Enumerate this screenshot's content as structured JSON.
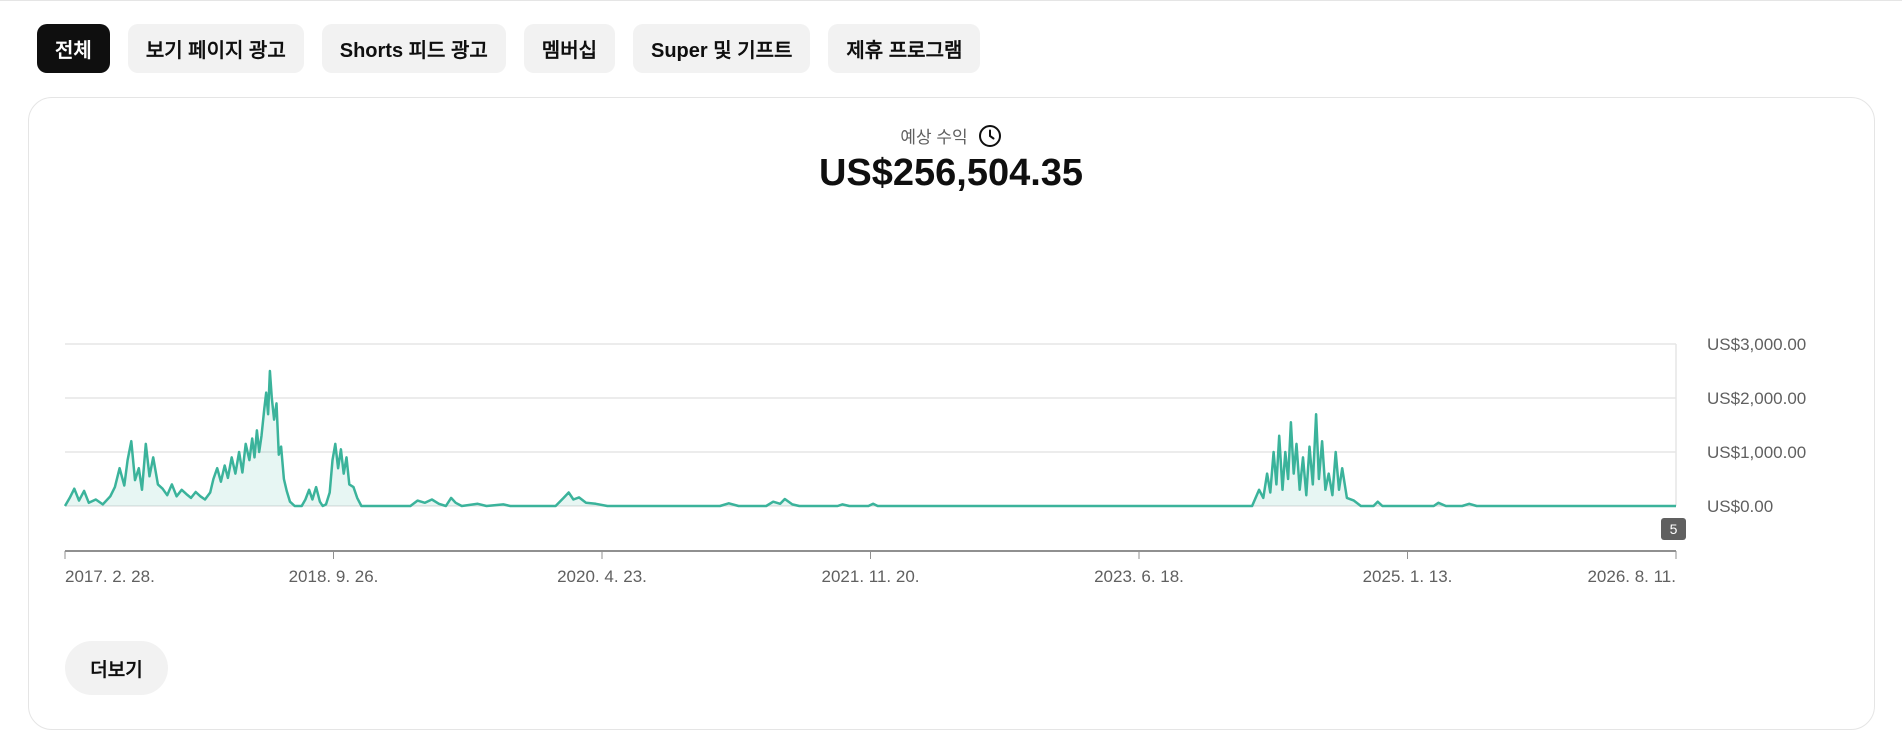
{
  "tabs": [
    {
      "label": "전체",
      "active": true
    },
    {
      "label": "보기 페이지 광고",
      "active": false
    },
    {
      "label": "Shorts 피드 광고",
      "active": false
    },
    {
      "label": "멤버십",
      "active": false
    },
    {
      "label": "Super 및 기프트",
      "active": false
    },
    {
      "label": "제휴 프로그램",
      "active": false
    }
  ],
  "metric": {
    "label": "예상 수익",
    "icon": "clock-icon",
    "value": "US$256,504.35"
  },
  "more_button": {
    "label": "더보기"
  },
  "colors": {
    "accent": "#3bb39b",
    "active_chip": "#0f0f0f",
    "chip": "#f2f2f2",
    "grid": "#e5e5e5"
  },
  "chart_data": {
    "type": "area",
    "title": "",
    "xlabel": "",
    "ylabel": "",
    "x_tick_labels": [
      "2017. 2. 28.",
      "2018. 9. 26.",
      "2020. 4. 23.",
      "2021. 11. 20.",
      "2023. 6. 18.",
      "2025. 1. 13.",
      "2026. 8. 11."
    ],
    "x_range": [
      "2017-02-28",
      "2026-08-11"
    ],
    "y_tick_labels": [
      "US$0.00",
      "US$1,000.00",
      "US$2,000.00",
      "US$3,000.00"
    ],
    "ylim": [
      0,
      3000
    ],
    "grid": true,
    "axis_position": "right",
    "marker_badge": "5",
    "series": [
      {
        "points": [
          [
            "2017-02-28",
            0
          ],
          [
            "2017-03-10",
            150
          ],
          [
            "2017-03-20",
            320
          ],
          [
            "2017-03-30",
            100
          ],
          [
            "2017-04-10",
            280
          ],
          [
            "2017-04-20",
            60
          ],
          [
            "2017-05-05",
            120
          ],
          [
            "2017-05-20",
            30
          ],
          [
            "2017-06-05",
            180
          ],
          [
            "2017-06-15",
            350
          ],
          [
            "2017-06-25",
            700
          ],
          [
            "2017-07-05",
            380
          ],
          [
            "2017-07-12",
            850
          ],
          [
            "2017-07-20",
            1200
          ],
          [
            "2017-07-28",
            480
          ],
          [
            "2017-08-05",
            700
          ],
          [
            "2017-08-12",
            300
          ],
          [
            "2017-08-20",
            1150
          ],
          [
            "2017-08-28",
            550
          ],
          [
            "2017-09-05",
            900
          ],
          [
            "2017-09-15",
            400
          ],
          [
            "2017-09-25",
            320
          ],
          [
            "2017-10-05",
            200
          ],
          [
            "2017-10-15",
            400
          ],
          [
            "2017-10-25",
            180
          ],
          [
            "2017-11-05",
            300
          ],
          [
            "2017-11-15",
            220
          ],
          [
            "2017-11-25",
            150
          ],
          [
            "2017-12-05",
            260
          ],
          [
            "2017-12-15",
            180
          ],
          [
            "2017-12-25",
            120
          ],
          [
            "2018-01-05",
            250
          ],
          [
            "2018-01-12",
            500
          ],
          [
            "2018-01-20",
            700
          ],
          [
            "2018-01-28",
            450
          ],
          [
            "2018-02-05",
            750
          ],
          [
            "2018-02-12",
            520
          ],
          [
            "2018-02-20",
            900
          ],
          [
            "2018-02-28",
            600
          ],
          [
            "2018-03-08",
            1000
          ],
          [
            "2018-03-15",
            620
          ],
          [
            "2018-03-22",
            1150
          ],
          [
            "2018-03-30",
            850
          ],
          [
            "2018-04-05",
            1250
          ],
          [
            "2018-04-10",
            900
          ],
          [
            "2018-04-15",
            1400
          ],
          [
            "2018-04-20",
            1000
          ],
          [
            "2018-04-25",
            1300
          ],
          [
            "2018-05-01",
            1800
          ],
          [
            "2018-05-05",
            2100
          ],
          [
            "2018-05-09",
            1700
          ],
          [
            "2018-05-13",
            2500
          ],
          [
            "2018-05-17",
            2000
          ],
          [
            "2018-05-22",
            1600
          ],
          [
            "2018-05-27",
            1900
          ],
          [
            "2018-06-01",
            950
          ],
          [
            "2018-06-06",
            1100
          ],
          [
            "2018-06-12",
            500
          ],
          [
            "2018-06-18",
            280
          ],
          [
            "2018-06-25",
            80
          ],
          [
            "2018-07-05",
            0
          ],
          [
            "2018-07-20",
            0
          ],
          [
            "2018-07-28",
            120
          ],
          [
            "2018-08-05",
            300
          ],
          [
            "2018-08-12",
            120
          ],
          [
            "2018-08-20",
            350
          ],
          [
            "2018-08-28",
            80
          ],
          [
            "2018-09-03",
            0
          ],
          [
            "2018-09-10",
            30
          ],
          [
            "2018-09-18",
            250
          ],
          [
            "2018-09-24",
            850
          ],
          [
            "2018-09-30",
            1150
          ],
          [
            "2018-10-06",
            700
          ],
          [
            "2018-10-12",
            1050
          ],
          [
            "2018-10-18",
            600
          ],
          [
            "2018-10-24",
            900
          ],
          [
            "2018-10-30",
            400
          ],
          [
            "2018-11-08",
            350
          ],
          [
            "2018-11-16",
            150
          ],
          [
            "2018-11-25",
            0
          ],
          [
            "2019-03-10",
            0
          ],
          [
            "2019-03-25",
            100
          ],
          [
            "2019-04-10",
            60
          ],
          [
            "2019-04-25",
            120
          ],
          [
            "2019-05-10",
            40
          ],
          [
            "2019-05-25",
            0
          ],
          [
            "2019-06-05",
            150
          ],
          [
            "2019-06-15",
            60
          ],
          [
            "2019-06-28",
            0
          ],
          [
            "2019-08-01",
            40
          ],
          [
            "2019-08-20",
            0
          ],
          [
            "2019-09-25",
            30
          ],
          [
            "2019-10-10",
            0
          ],
          [
            "2019-11-10",
            0
          ],
          [
            "2020-01-15",
            0
          ],
          [
            "2020-02-01",
            150
          ],
          [
            "2020-02-12",
            250
          ],
          [
            "2020-02-22",
            120
          ],
          [
            "2020-03-05",
            160
          ],
          [
            "2020-03-20",
            60
          ],
          [
            "2020-04-10",
            40
          ],
          [
            "2020-05-05",
            0
          ],
          [
            "2021-01-01",
            0
          ],
          [
            "2021-01-20",
            50
          ],
          [
            "2021-02-10",
            0
          ],
          [
            "2021-04-10",
            0
          ],
          [
            "2021-04-25",
            80
          ],
          [
            "2021-05-10",
            40
          ],
          [
            "2021-05-20",
            130
          ],
          [
            "2021-06-05",
            30
          ],
          [
            "2021-06-20",
            0
          ],
          [
            "2021-09-10",
            0
          ],
          [
            "2021-09-20",
            30
          ],
          [
            "2021-10-05",
            0
          ],
          [
            "2021-11-15",
            0
          ],
          [
            "2021-11-25",
            40
          ],
          [
            "2021-12-05",
            0
          ],
          [
            "2024-02-15",
            0
          ],
          [
            "2024-03-01",
            300
          ],
          [
            "2024-03-10",
            150
          ],
          [
            "2024-03-18",
            600
          ],
          [
            "2024-03-25",
            250
          ],
          [
            "2024-04-01",
            1000
          ],
          [
            "2024-04-07",
            400
          ],
          [
            "2024-04-13",
            1300
          ],
          [
            "2024-04-20",
            300
          ],
          [
            "2024-04-26",
            1000
          ],
          [
            "2024-05-02",
            500
          ],
          [
            "2024-05-08",
            1550
          ],
          [
            "2024-05-14",
            600
          ],
          [
            "2024-05-20",
            1150
          ],
          [
            "2024-05-27",
            300
          ],
          [
            "2024-06-03",
            900
          ],
          [
            "2024-06-10",
            200
          ],
          [
            "2024-06-17",
            1100
          ],
          [
            "2024-06-24",
            400
          ],
          [
            "2024-07-01",
            1700
          ],
          [
            "2024-07-07",
            500
          ],
          [
            "2024-07-14",
            1200
          ],
          [
            "2024-07-21",
            300
          ],
          [
            "2024-07-28",
            600
          ],
          [
            "2024-08-05",
            200
          ],
          [
            "2024-08-12",
            1000
          ],
          [
            "2024-08-19",
            300
          ],
          [
            "2024-08-26",
            700
          ],
          [
            "2024-09-05",
            150
          ],
          [
            "2024-09-20",
            100
          ],
          [
            "2024-10-05",
            0
          ],
          [
            "2024-11-01",
            0
          ],
          [
            "2024-11-10",
            80
          ],
          [
            "2024-11-20",
            0
          ],
          [
            "2025-03-10",
            0
          ],
          [
            "2025-03-20",
            60
          ],
          [
            "2025-04-05",
            0
          ],
          [
            "2025-05-10",
            0
          ],
          [
            "2025-05-25",
            40
          ],
          [
            "2025-06-10",
            0
          ],
          [
            "2026-08-11",
            0
          ]
        ]
      }
    ]
  }
}
